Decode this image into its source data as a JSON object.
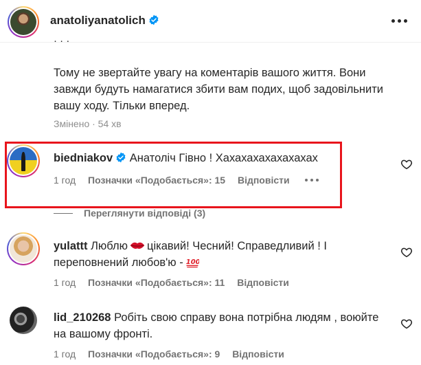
{
  "header": {
    "username": "anatoliyanatolich",
    "more_icon": "more-horizontal-icon"
  },
  "caption": {
    "partial_line": "·  ·  ·",
    "text": "Тому не звертайте увагу на коментарів вашого життя. Вони завжди будуть намагатися збити вам подих, щоб задовільнити вашу ходу. Тільки вперед.",
    "meta": "Змінено · 54 хв"
  },
  "comments": [
    {
      "username": "biedniakov",
      "verified": true,
      "text": "Анатоліч Гівно ! Хахахахахахахахах",
      "time": "1 год",
      "likes": "Позначки «Подобається»: 15",
      "reply": "Відповісти",
      "view_replies": "Переглянути відповіді (3)"
    },
    {
      "username": "yulattt",
      "text_before": "Люблю",
      "text_mid": "цікавий! Чесний! Справедливий ! І переповнений любов'ю -",
      "time": "1 год",
      "likes": "Позначки «Подобається»: 11",
      "reply": "Відповісти"
    },
    {
      "username": "lid_210268",
      "text": "Робіть свою справу вона потрібна людям , воюйте на вашому фронті.",
      "time": "1 год",
      "likes": "Позначки «Подобається»: 9",
      "reply": "Відповісти"
    }
  ],
  "colors": {
    "highlight": "#e8141c",
    "verified": "#0095f6",
    "text": "#262626",
    "meta": "#737373"
  }
}
